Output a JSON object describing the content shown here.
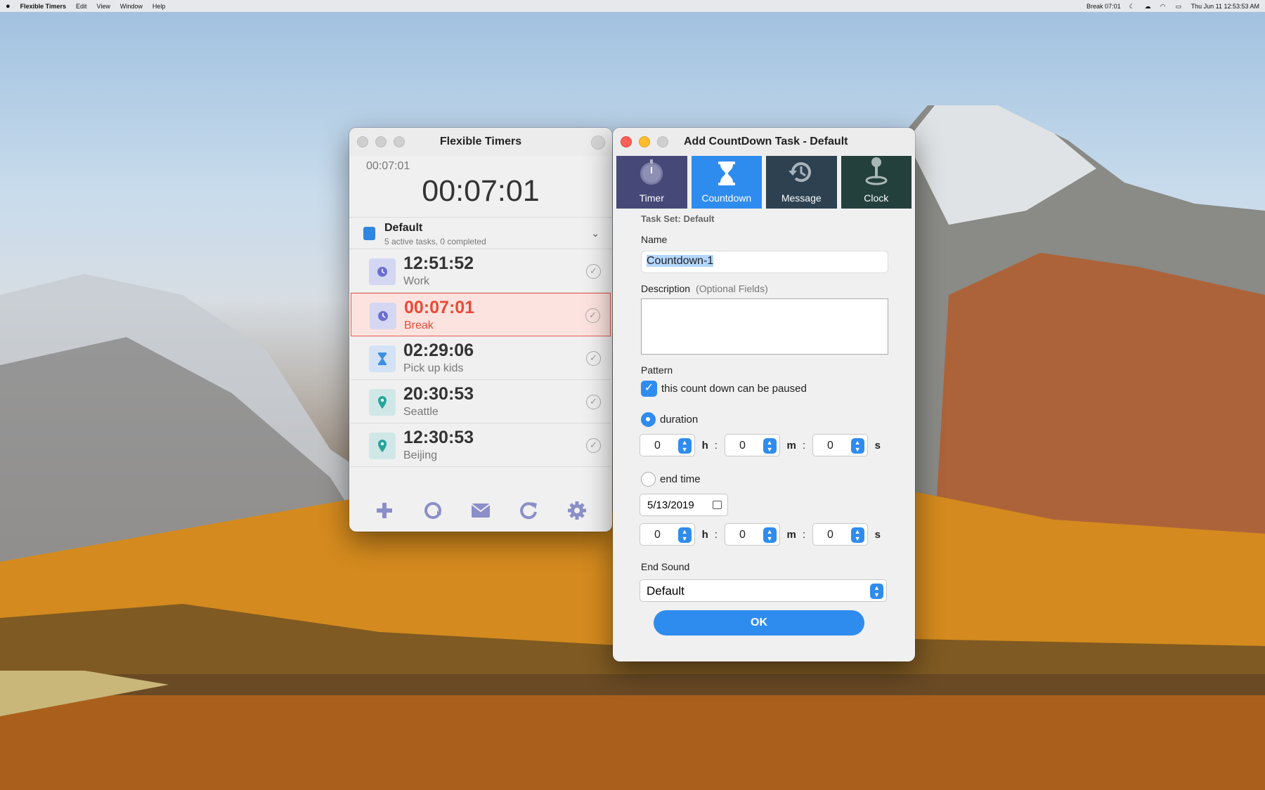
{
  "menubar": {
    "app_name": "Flexible Timers",
    "menus": [
      "Edit",
      "View",
      "Window",
      "Help"
    ],
    "status_text": "Break 07:01",
    "clock_text": "Thu Jun 11  12:53:53 AM"
  },
  "timers_window": {
    "title": "Flexible Timers",
    "small_clock": "00:07:01",
    "big_clock": "00:07:01",
    "task_set": {
      "name": "Default",
      "summary": "5 active tasks, 0 completed"
    },
    "tasks": [
      {
        "time": "12:51:52",
        "label": "Work",
        "icon": "clock-icon"
      },
      {
        "time": "00:07:01",
        "label": "Break",
        "icon": "clock-icon",
        "active": true
      },
      {
        "time": "02:29:06",
        "label": "Pick up kids",
        "icon": "hourglass-icon"
      },
      {
        "time": "20:30:53",
        "label": "Seattle",
        "icon": "location-pin-icon"
      },
      {
        "time": "12:30:53",
        "label": "Beijing",
        "icon": "location-pin-icon"
      }
    ],
    "toolbar_icons": [
      "plus-icon",
      "repeat-timer-icon",
      "mail-icon",
      "refresh-icon",
      "gear-icon"
    ]
  },
  "add_window": {
    "title": "Add CountDown Task - Default",
    "tabs": [
      {
        "label": "Timer",
        "icon": "stopwatch-icon"
      },
      {
        "label": "Countdown",
        "icon": "hourglass-icon",
        "selected": true
      },
      {
        "label": "Message",
        "icon": "history-icon"
      },
      {
        "label": "Clock",
        "icon": "pin-icon"
      }
    ],
    "task_set_label": "Task Set: Default",
    "name_label": "Name",
    "name_value": "Countdown-1",
    "description_label": "Description",
    "description_optional": "(Optional Fields)",
    "description_value": "",
    "pattern_label": "Pattern",
    "pausable_label": "this count down can be paused",
    "pausable_checked": true,
    "duration_label": "duration",
    "duration": {
      "h": "0",
      "m": "0",
      "s": "0"
    },
    "end_time_label": "end time",
    "end_date": "5/13/2019",
    "end_time": {
      "h": "0",
      "m": "0",
      "s": "0"
    },
    "unit_h": "h",
    "unit_m": "m",
    "unit_s": "s",
    "colon": ":",
    "end_sound_label": "End Sound",
    "end_sound_value": "Default",
    "ok_label": "OK"
  },
  "colors": {
    "accent": "#2f8cef",
    "active_task": "#e94a36",
    "tab_timer": "#464878",
    "tab_message": "#2d4150",
    "tab_clock": "#23403d"
  }
}
